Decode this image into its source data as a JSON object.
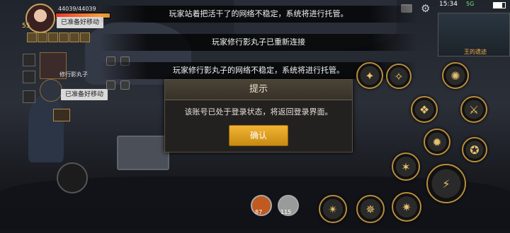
{
  "status_bar": {
    "time": "15:34",
    "network": "5G"
  },
  "notices": [
    {
      "text": "玩家站着把活干了的网络不稳定，系统将进行托管。"
    },
    {
      "text": "玩家修行影丸子已重新连接"
    },
    {
      "text": "玩家修行影丸子的网络不稳定，系统将进行托管。"
    }
  ],
  "dialog": {
    "title": "提示",
    "message": "该账号已处于登录状态，将返回登录界面。",
    "confirm_label": "确认"
  },
  "player": {
    "level": "55",
    "hp_text": "44039/44039",
    "hp_fraction": 1.0,
    "ready_status": "已准备好移动"
  },
  "party": {
    "member_name": "修行影丸子",
    "ready_status": "已准备好移动"
  },
  "minimap": {
    "location_label": "王的遗迹"
  },
  "potions": [
    {
      "count": "87"
    },
    {
      "count": "115"
    }
  ],
  "icons": {
    "settings": "gear-icon",
    "chat": "chat-icon",
    "battery": "battery-icon"
  },
  "colors": {
    "accent": "#e09a17",
    "frame": "#b88d3a",
    "location": "#ffb04a"
  }
}
